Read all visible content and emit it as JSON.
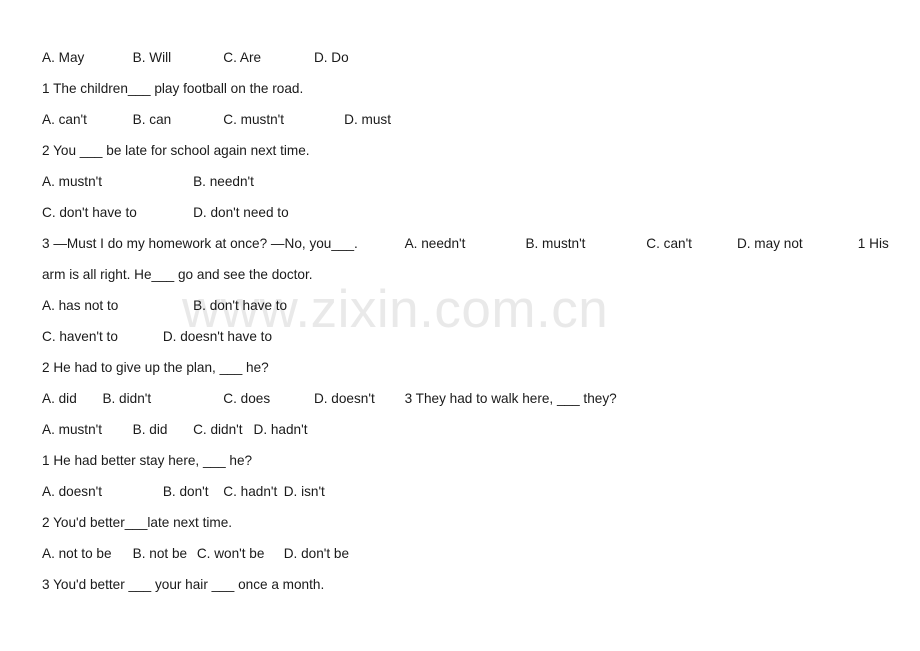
{
  "document": {
    "type": "worksheet",
    "watermark": "www.zixin.com.cn",
    "background_color": "#ffffff",
    "text_color": "#1a1a1a",
    "watermark_color": "#e9e9e9",
    "lines": [
      {
        "id": "l1",
        "text": "A. May\t\tB. Will\t\tC. Are\t\tD. Do"
      },
      {
        "id": "l2",
        "text": "1 The children___ play football on the road."
      },
      {
        "id": "l3",
        "text": "A. can't\t\tB. can\t\tC. mustn't\t\tD. must"
      },
      {
        "id": "l4",
        "text": "2 You ___ be late for school again next time."
      },
      {
        "id": "l5",
        "text": "A. mustn't\t\t\tB. needn't"
      },
      {
        "id": "l6",
        "text": "C. don't have to\t\tD. don't need to"
      },
      {
        "id": "l7",
        "text": "3 —Must I do my homework at once? —No, you___.\t\tA. needn't\t\tB. mustn't\t\tC. can't\t\tD. may not\t\t1 His arm is all right. He___ go and see the doctor."
      },
      {
        "id": "l8",
        "text": "A. has not to\t\t\tB. don't have to"
      },
      {
        "id": "l9",
        "text": "C. haven't to\t\tD. doesn't have to"
      },
      {
        "id": "l10",
        "text": "2 He had to give up the plan, ___ he?"
      },
      {
        "id": "l11",
        "text": "A. did\tB. didn't\t\t\tC. does\t\tD. doesn't\t3 They had to walk here, ___ they?"
      },
      {
        "id": "l12",
        "text": "A. mustn't\tB. did\tC. didn't\tD. hadn't"
      },
      {
        "id": "l13",
        "text": "1 He had better stay here, ___ he?"
      },
      {
        "id": "l14",
        "text": "A. doesn't\t\tB. don't\tC. hadn't\tD. isn't"
      },
      {
        "id": "l15",
        "text": "2 You'd better___late next time."
      },
      {
        "id": "l16",
        "text": "A. not to be\tB. not be\t C. won't be\tD. don't be"
      },
      {
        "id": "l17",
        "text": "3 You'd better ___ your hair ___ once a month."
      }
    ]
  }
}
